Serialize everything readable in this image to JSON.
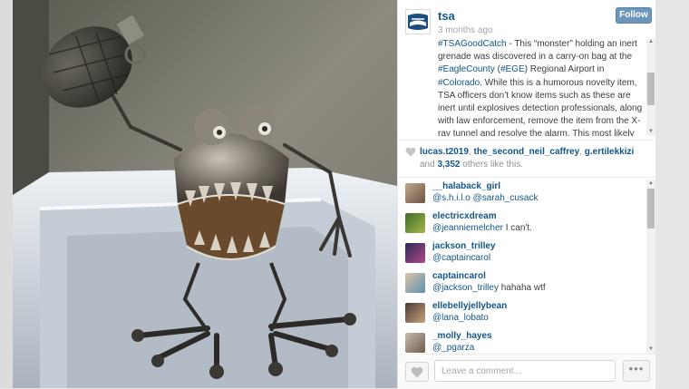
{
  "post": {
    "username": "tsa",
    "timestamp": "3 months ago",
    "follow_label": "Follow",
    "caption": [
      {
        "t": "#TSAGoodCatch",
        "tag": true
      },
      {
        "t": " - This “monster” holding an inert grenade was discovered in a carry-on bag at the ",
        "tag": false
      },
      {
        "t": "#EagleCounty",
        "tag": true
      },
      {
        "t": " (",
        "tag": false
      },
      {
        "t": "#EGE",
        "tag": true
      },
      {
        "t": ") Regional Airport in ",
        "tag": false
      },
      {
        "t": "#Colorado",
        "tag": true
      },
      {
        "t": ". While this is a humorous novelty item, TSA officers don’t know items such as these are inert until explosives detection professionals, along with law enforcement, remove the item from the X-ray tunnel and resolve the alarm. This most likely will cause a",
        "tag": false
      }
    ]
  },
  "likes": {
    "users": [
      "lucas.t2019",
      "the_second_neil_caffrey",
      "g.ertilekkizi"
    ],
    "and_word": "and",
    "others_count": "3,352",
    "others_suffix": "others like this."
  },
  "comments": [
    {
      "user": "__halaback_girl",
      "mentions": [
        "@s.h.i.l.o",
        "@sarah_cusack"
      ],
      "text": ""
    },
    {
      "user": "electricxdream",
      "mentions": [
        "@jeanniemelcher"
      ],
      "text": "I can't."
    },
    {
      "user": "jackson_trilley",
      "mentions": [
        "@captaincarol"
      ],
      "text": ""
    },
    {
      "user": "captaincarol",
      "mentions": [
        "@jackson_trilley"
      ],
      "text": "hahaha wtf"
    },
    {
      "user": "ellebellyjellybean",
      "mentions": [
        "@lana_lobato"
      ],
      "text": ""
    },
    {
      "user": "_molly_hayes",
      "mentions": [
        "@_pgarza"
      ],
      "text": ""
    }
  ],
  "footer": {
    "comment_placeholder": "Leave a comment...",
    "more_label": "•••"
  },
  "colors": {
    "link": "#125688",
    "follow_button": "#6d96bb"
  },
  "icons": {
    "avatar": "tsa-logo-icon",
    "like": "heart-icon",
    "more": "ellipsis-icon"
  }
}
